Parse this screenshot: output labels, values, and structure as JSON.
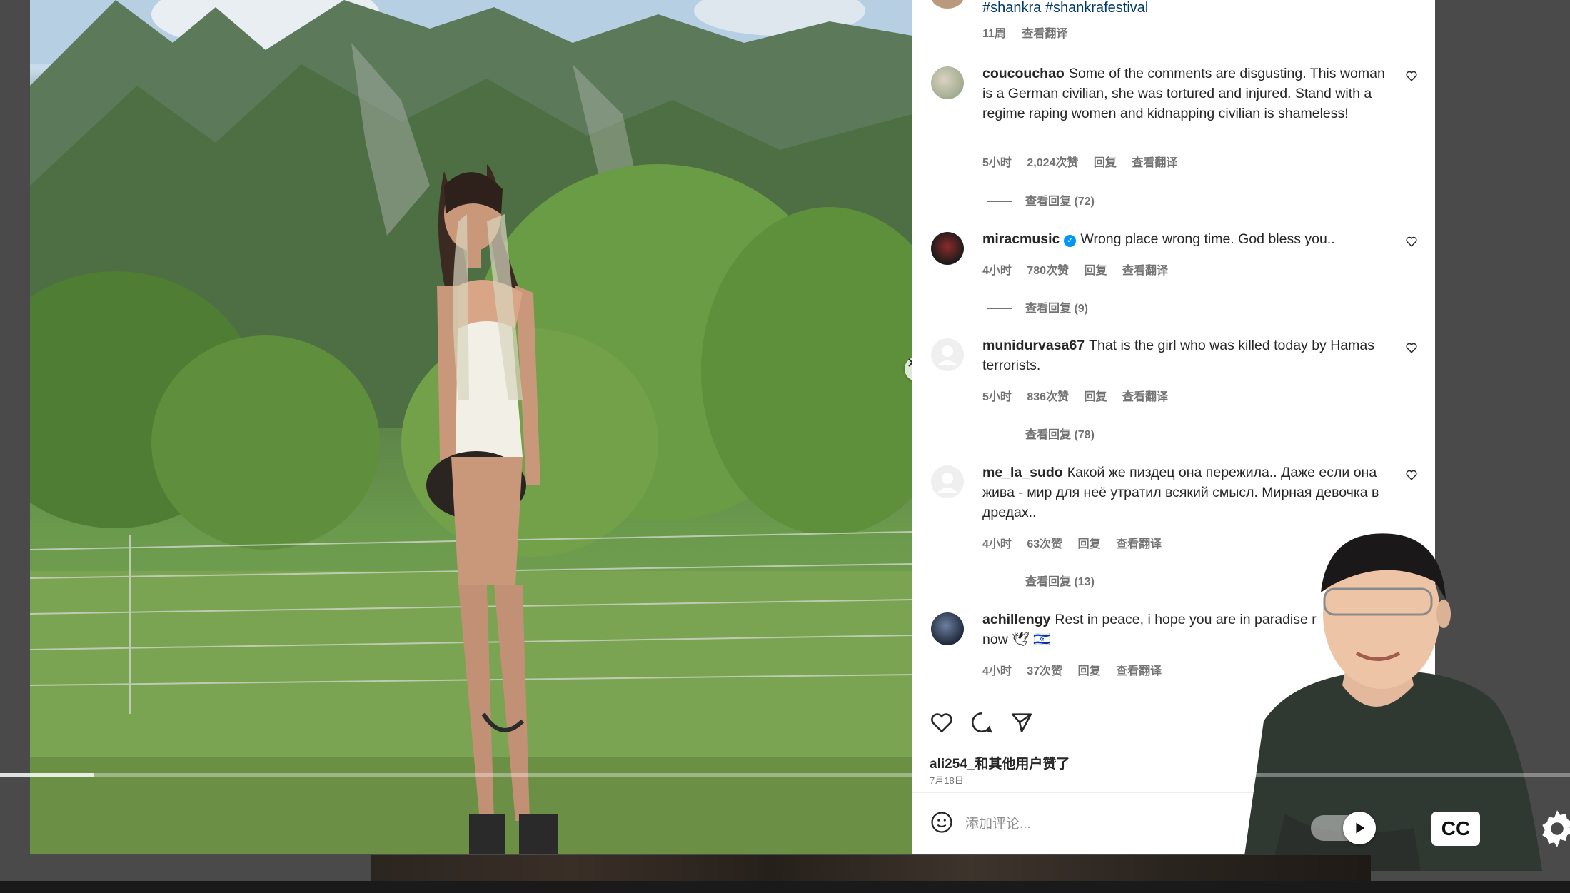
{
  "post": {
    "hashtags": "#shankra #shankrafestival",
    "age": "11周",
    "see_translation": "查看翻译"
  },
  "comments": [
    {
      "username": "coucouchao",
      "text": "Some of the comments are disgusting. This woman is a German civilian, she was tortured and injured. Stand with a regime raping women and kidnapping civilian is shameless!",
      "time": "5小时",
      "likes": "2,024次赞",
      "reply": "回复",
      "translate": "查看翻译",
      "view_replies": "查看回复 (72)"
    },
    {
      "username": "miracmusic",
      "verified": true,
      "text": "Wrong place wrong time. God bless you..",
      "time": "4小时",
      "likes": "780次赞",
      "reply": "回复",
      "translate": "查看翻译",
      "view_replies": "查看回复 (9)"
    },
    {
      "username": "munidurvasa67",
      "text": "That is the girl who was killed today by Hamas terrorists.",
      "time": "5小时",
      "likes": "836次赞",
      "reply": "回复",
      "translate": "查看翻译",
      "view_replies": "查看回复 (78)"
    },
    {
      "username": "me_la_sudo",
      "text": "Какой же пиздец она пережила.. Даже если она жива - мир для неё утратил всякий смысл. Мирная девочка в дредах..",
      "time": "4小时",
      "likes": "63次赞",
      "reply": "回复",
      "translate": "查看翻译",
      "view_replies": "查看回复 (13)"
    },
    {
      "username": "achillengy",
      "text": "Rest in peace, i hope you are in paradise r",
      "text_line2": "now 🕊 🇮🇱",
      "time": "4小时",
      "likes": "37次赞",
      "reply": "回复",
      "translate": "查看翻译"
    }
  ],
  "footer": {
    "liked_by": "ali254_和其他用户赞了",
    "date": "7月18日",
    "add_comment_placeholder": "添加评论..."
  },
  "video": {
    "progress_fraction": 0.06,
    "cc_label": "CC"
  },
  "icons": {
    "next": "chevron-right-icon",
    "like": "heart-icon",
    "comment": "comment-bubble-icon",
    "share": "paper-plane-icon",
    "emoji": "smiley-icon",
    "play": "play-icon",
    "settings": "gear-icon"
  },
  "colors": {
    "link": "#00376b",
    "muted": "#737373",
    "text": "#262626",
    "verified": "#0095f6"
  }
}
